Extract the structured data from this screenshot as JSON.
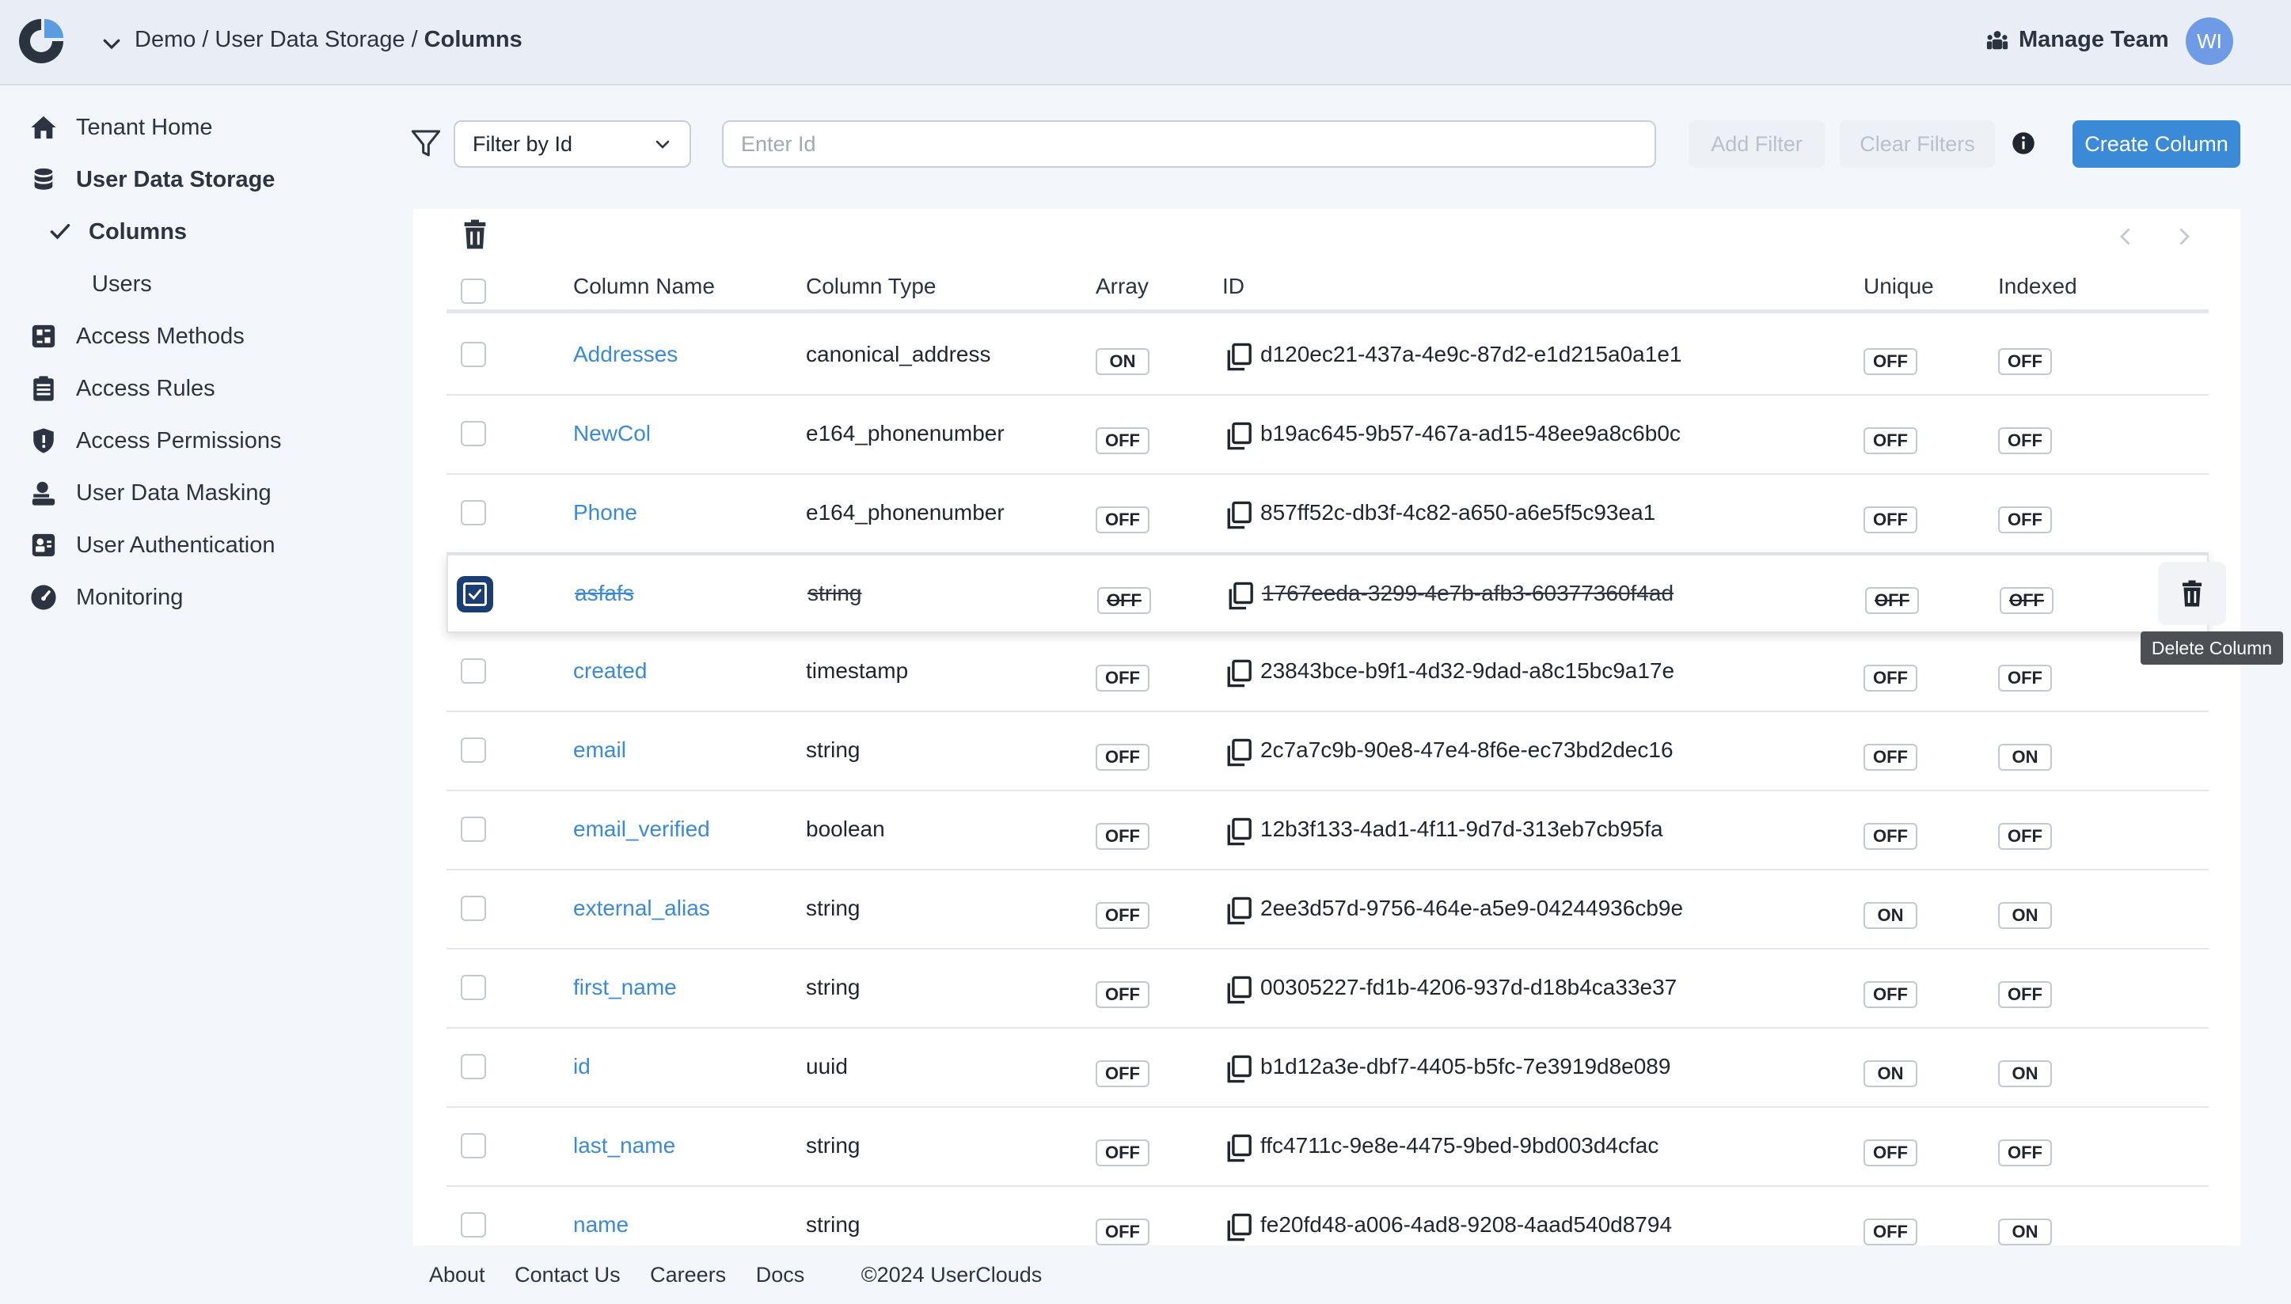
{
  "header": {
    "breadcrumb": [
      "Demo",
      "User Data Storage",
      "Columns"
    ],
    "manage_team_label": "Manage Team",
    "avatar_initials": "WI"
  },
  "sidebar": {
    "items": [
      {
        "label": "Tenant Home",
        "icon": "home-icon"
      },
      {
        "label": "User Data Storage",
        "icon": "database-icon"
      },
      {
        "label": "Columns",
        "icon": "checkmark-icon"
      },
      {
        "label": "Users",
        "icon": ""
      },
      {
        "label": "Access Methods",
        "icon": "access-methods-icon"
      },
      {
        "label": "Access Rules",
        "icon": "clipboard-icon"
      },
      {
        "label": "Access Permissions",
        "icon": "shield-icon"
      },
      {
        "label": "User Data Masking",
        "icon": "masking-icon"
      },
      {
        "label": "User Authentication",
        "icon": "authentication-icon"
      },
      {
        "label": "Monitoring",
        "icon": "gauge-icon"
      }
    ]
  },
  "toolbar": {
    "filter_select_value": "Filter by Id",
    "id_input_placeholder": "Enter Id",
    "add_filter_label": "Add Filter",
    "clear_filters_label": "Clear Filters",
    "create_column_label": "Create Column"
  },
  "table": {
    "headers": [
      "Column Name",
      "Column Type",
      "Array",
      "ID",
      "Unique",
      "Indexed"
    ],
    "rows": [
      {
        "name": "Addresses",
        "type": "canonical_address",
        "array": "ON",
        "id": "d120ec21-437a-4e9c-87d2-e1d215a0a1e1",
        "unique": "OFF",
        "indexed": "OFF"
      },
      {
        "name": "NewCol",
        "type": "e164_phonenumber",
        "array": "OFF",
        "id": "b19ac645-9b57-467a-ad15-48ee9a8c6b0c",
        "unique": "OFF",
        "indexed": "OFF"
      },
      {
        "name": "Phone",
        "type": "e164_phonenumber",
        "array": "OFF",
        "id": "857ff52c-db3f-4c82-a650-a6e5f5c93ea1",
        "unique": "OFF",
        "indexed": "OFF"
      },
      {
        "name": "asfafs",
        "type": "string",
        "array": "OFF",
        "id": "1767eeda-3299-4e7b-afb3-60377360f4ad",
        "unique": "OFF",
        "indexed": "OFF"
      },
      {
        "name": "created",
        "type": "timestamp",
        "array": "OFF",
        "id": "23843bce-b9f1-4d32-9dad-a8c15bc9a17e",
        "unique": "OFF",
        "indexed": "OFF"
      },
      {
        "name": "email",
        "type": "string",
        "array": "OFF",
        "id": "2c7a7c9b-90e8-47e4-8f6e-ec73bd2dec16",
        "unique": "OFF",
        "indexed": "ON"
      },
      {
        "name": "email_verified",
        "type": "boolean",
        "array": "OFF",
        "id": "12b3f133-4ad1-4f11-9d7d-313eb7cb95fa",
        "unique": "OFF",
        "indexed": "OFF"
      },
      {
        "name": "external_alias",
        "type": "string",
        "array": "OFF",
        "id": "2ee3d57d-9756-464e-a5e9-04244936cb9e",
        "unique": "ON",
        "indexed": "ON"
      },
      {
        "name": "first_name",
        "type": "string",
        "array": "OFF",
        "id": "00305227-fd1b-4206-937d-d18b4ca33e37",
        "unique": "OFF",
        "indexed": "OFF"
      },
      {
        "name": "id",
        "type": "uuid",
        "array": "OFF",
        "id": "b1d12a3e-dbf7-4405-b5fc-7e3919d8e089",
        "unique": "ON",
        "indexed": "ON"
      },
      {
        "name": "last_name",
        "type": "string",
        "array": "OFF",
        "id": "ffc4711c-9e8e-4475-9bed-9bd003d4cfac",
        "unique": "OFF",
        "indexed": "OFF"
      },
      {
        "name": "name",
        "type": "string",
        "array": "OFF",
        "id": "fe20fd48-a006-4ad8-9208-4aad540d8794",
        "unique": "OFF",
        "indexed": "ON"
      }
    ],
    "selected_row_index": 3,
    "delete_tooltip": "Delete Column"
  },
  "footer": {
    "links": [
      "About",
      "Contact Us",
      "Careers",
      "Docs"
    ],
    "copyright": "©2024 UserClouds"
  },
  "colors": {
    "accent": "#3a8ad8",
    "selected_checkbox": "#1a3d72",
    "avatar": "#6f9ae6"
  }
}
